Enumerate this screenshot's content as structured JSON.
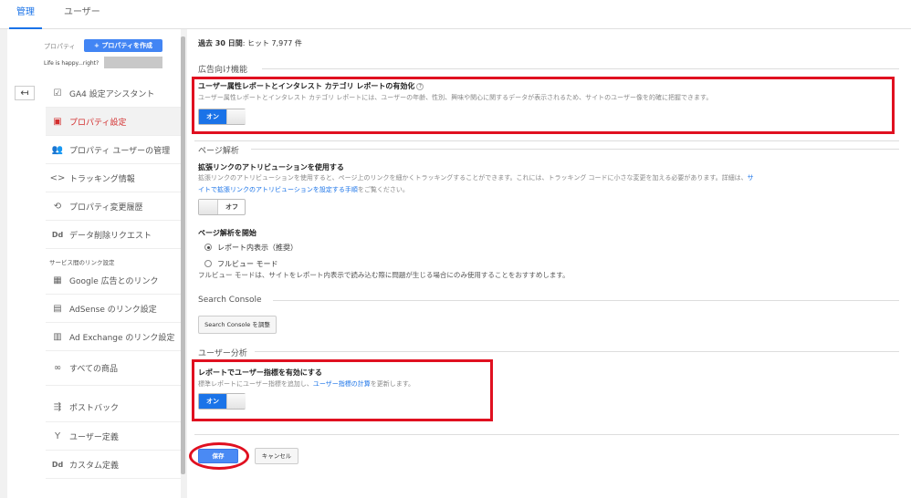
{
  "tabs": [
    {
      "label": "管理",
      "active": true
    },
    {
      "label": "ユーザー",
      "active": false
    }
  ],
  "sidebar": {
    "property_label": "プロパティ",
    "create_button": "プロパティを作成",
    "account_name": "Life is happy...right?",
    "items": [
      {
        "icon": "checklist-icon",
        "label": "GA4 設定アシスタント"
      },
      {
        "icon": "window-icon",
        "label": "プロパティ設定",
        "active": true
      },
      {
        "icon": "users-icon",
        "label": "プロパティ ユーザーの管理"
      },
      {
        "icon": "code-icon",
        "label": "トラッキング情報"
      },
      {
        "icon": "history-icon",
        "label": "プロパティ変更履歴"
      },
      {
        "icon": "dd-icon",
        "label": "データ削除リクエスト"
      }
    ],
    "section_heading": "サービス間のリンク設定",
    "link_items": [
      {
        "icon": "grid-icon",
        "label": "Google 広告とのリンク"
      },
      {
        "icon": "adsense-icon",
        "label": "AdSense のリンク設定"
      },
      {
        "icon": "adexchange-icon",
        "label": "Ad Exchange のリンク設定"
      },
      {
        "icon": "link-icon",
        "label": "すべての商品"
      },
      {
        "icon": "postback-icon",
        "label": "ポストバック"
      },
      {
        "icon": "fork-icon",
        "label": "ユーザー定義"
      },
      {
        "icon": "dd-icon",
        "label": "カスタム定義"
      }
    ]
  },
  "main": {
    "hits_prefix": "過去 30 日間",
    "hits_text": ": ヒット 7,977 件",
    "ads_section": "広告向け機能",
    "demographics_title": "ユーザー属性レポートとインタレスト カテゴリ レポートの有効化",
    "demographics_desc": "ユーザー属性レポートとインタレスト カテゴリ レポートには、ユーザーの年齢、性別、興味や関心に関するデータが表示されるため、サイトのユーザー像を的確に把握できます。",
    "toggle_on": "オン",
    "toggle_off": "オフ",
    "page_analytics_section": "ページ解析",
    "enhanced_link_title": "拡張リンクのアトリビューションを使用する",
    "enhanced_link_desc1": "拡張リンクのアトリビューションを使用すると、ページ上のリンクを細かくトラッキングすることができます。これには、トラッキング コードに小さな変更を加える必要があります。詳細は、",
    "enhanced_link_desc1_link": "サ",
    "enhanced_link_desc2_link": "イトで拡張リンクのアトリビューションを設定する手順",
    "enhanced_link_desc2_suffix": "をご覧ください。",
    "page_analytics_start": "ページ解析を開始",
    "radio_inpage": "レポート内表示（推奨）",
    "radio_fullview": "フルビュー モード",
    "fullview_desc": "フルビュー モードは、サイトをレポート内表示で読み込む際に問題が生じる場合にのみ使用することをおすすめします。",
    "search_console_section": "Search Console",
    "search_console_button": "Search Console を調整",
    "user_analysis_section": "ユーザー分析",
    "user_metric_title": "レポートでユーザー指標を有効にする",
    "user_metric_desc_prefix": "標準レポートにユーザー指標を追加し、",
    "user_metric_desc_link": "ユーザー指標の計算",
    "user_metric_desc_suffix": "を更新します。",
    "save_button": "保存",
    "cancel_button": "キャンセル"
  },
  "colors": {
    "accent": "#1a73e8",
    "highlight": "#e01020",
    "active_nav": "#d32f2f"
  }
}
